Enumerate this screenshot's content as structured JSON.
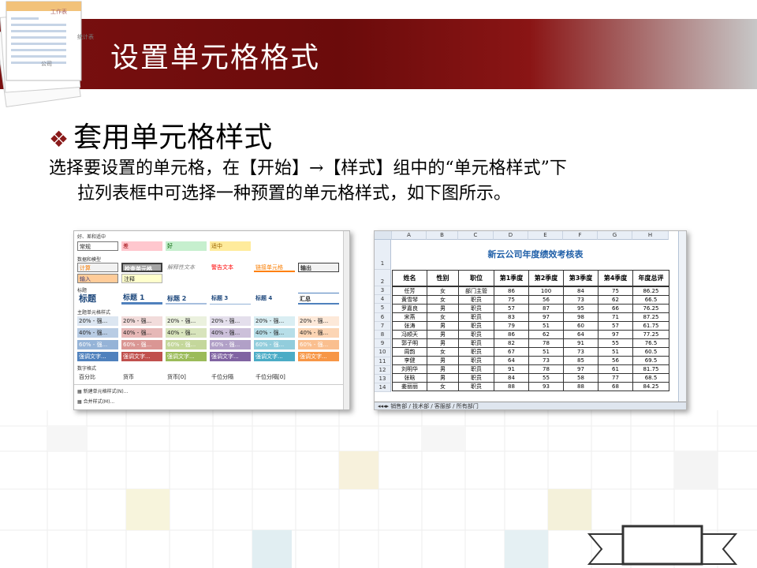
{
  "slide": {
    "title": "设置单元格格式",
    "subtitle": "套用单元格样式",
    "paragraph_line1": "选择要设置的单元格，在【开始】→【样式】组中的“单元格样式”下",
    "paragraph_line2": "拉列表框中可选择一种预置的单元格样式，如下图所示。"
  },
  "deck_icon_text": {
    "a": "工作表",
    "b": "统计表",
    "c": "公司"
  },
  "style_panel": {
    "sections": [
      "好、差和适中",
      "数据和模型",
      "标题",
      "主题单元格样式",
      "数字格式"
    ],
    "good_bad": [
      "常规",
      "差",
      "好",
      "适中"
    ],
    "data_model_row1": [
      "计算",
      "检查单元格",
      "解释性文本",
      "警告文本",
      "链接单元格",
      "输出"
    ],
    "data_model_row2": [
      "输入",
      "注释"
    ],
    "titles": [
      "标题",
      "标题 1",
      "标题 2",
      "标题 3",
      "标题 4",
      "汇总"
    ],
    "theme_rows": [
      [
        "20% - 强...",
        "20% - 强...",
        "20% - 强...",
        "20% - 强...",
        "20% - 强...",
        "20% - 强..."
      ],
      [
        "40% - 强...",
        "40% - 强...",
        "40% - 强...",
        "40% - 强...",
        "40% - 强...",
        "40% - 强..."
      ],
      [
        "60% - 强...",
        "60% - 强...",
        "60% - 强...",
        "60% - 强...",
        "60% - 强...",
        "60% - 强..."
      ],
      [
        "强调文字...",
        "强调文字...",
        "强调文字...",
        "强调文字...",
        "强调文字...",
        "强调文字..."
      ]
    ],
    "number_formats": [
      "百分比",
      "货币",
      "货币[0]",
      "千位分隔",
      "千位分隔[0]"
    ],
    "menu": [
      "新建单元格样式(N)...",
      "合并样式(M)..."
    ]
  },
  "sheet": {
    "columns": [
      "A",
      "B",
      "C",
      "D",
      "E",
      "F",
      "G",
      "H"
    ],
    "title": "新云公司年度绩效考核表",
    "headers": [
      "姓名",
      "性别",
      "职位",
      "第1季度",
      "第2季度",
      "第3季度",
      "第4季度",
      "年度总评"
    ],
    "rows": [
      [
        "任芳",
        "女",
        "部门主管",
        "86",
        "100",
        "84",
        "75",
        "86.25"
      ],
      [
        "黄雪琴",
        "女",
        "职员",
        "75",
        "56",
        "73",
        "62",
        "66.5"
      ],
      [
        "罗嘉良",
        "男",
        "职员",
        "57",
        "87",
        "95",
        "66",
        "76.25"
      ],
      [
        "宋燕",
        "女",
        "职员",
        "83",
        "97",
        "98",
        "71",
        "87.25"
      ],
      [
        "张涛",
        "男",
        "职员",
        "79",
        "51",
        "60",
        "57",
        "61.75"
      ],
      [
        "冯顺天",
        "男",
        "职员",
        "86",
        "62",
        "64",
        "97",
        "77.25"
      ],
      [
        "郭子明",
        "男",
        "职员",
        "82",
        "78",
        "91",
        "55",
        "76.5"
      ],
      [
        "周韵",
        "女",
        "职员",
        "67",
        "51",
        "73",
        "51",
        "60.5"
      ],
      [
        "李健",
        "男",
        "职员",
        "64",
        "73",
        "85",
        "56",
        "69.5"
      ],
      [
        "刘明华",
        "男",
        "职员",
        "91",
        "78",
        "97",
        "61",
        "81.75"
      ],
      [
        "张晗",
        "男",
        "职员",
        "84",
        "55",
        "58",
        "77",
        "68.5"
      ],
      [
        "姜丽丽",
        "女",
        "职员",
        "88",
        "93",
        "88",
        "68",
        "84.25"
      ]
    ],
    "row_numbers": [
      "1",
      "2",
      "3",
      "4",
      "5",
      "6",
      "7",
      "8",
      "9",
      "10",
      "11",
      "12",
      "13",
      "14"
    ],
    "tabs": "销售部 / 技术部 / 客服部 / 所有部门"
  }
}
